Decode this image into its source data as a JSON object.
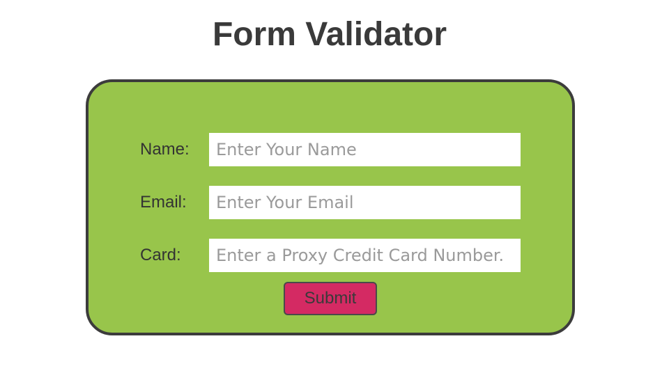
{
  "page": {
    "title": "Form Validator"
  },
  "form": {
    "fields": [
      {
        "label": "Name:",
        "placeholder": "Enter Your Name",
        "value": ""
      },
      {
        "label": "Email:",
        "placeholder": "Enter Your Email",
        "value": ""
      },
      {
        "label": "Card:",
        "placeholder": "Enter a Proxy Credit Card Number.",
        "value": ""
      }
    ],
    "submit_label": "Submit"
  },
  "colors": {
    "card_background": "#98c54b",
    "card_border": "#3c3c3c",
    "submit_background": "#d42a63",
    "title_text": "#3a3a3a"
  }
}
